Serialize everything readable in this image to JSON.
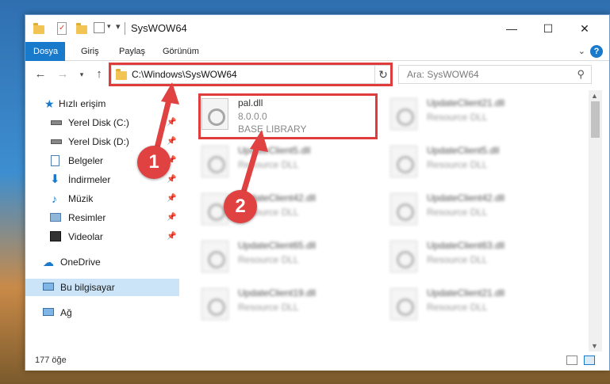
{
  "window": {
    "title": "SysWOW64",
    "controls": {
      "minimize": "—",
      "maximize": "☐",
      "close": "✕"
    }
  },
  "ribbon": {
    "tabs": [
      {
        "label": "Dosya",
        "active": true
      },
      {
        "label": "Giriş"
      },
      {
        "label": "Paylaş"
      },
      {
        "label": "Görünüm"
      }
    ],
    "help": "?"
  },
  "address": {
    "path": "C:\\Windows\\SysWOW64",
    "search_placeholder": "Ara: SysWOW64"
  },
  "sidebar": {
    "items": [
      {
        "label": "Hızlı erişim",
        "icon": "star-icon"
      },
      {
        "label": "Yerel Disk (C:)",
        "icon": "drive-icon",
        "pinned": true
      },
      {
        "label": "Yerel Disk (D:)",
        "icon": "drive-icon",
        "pinned": true
      },
      {
        "label": "Belgeler",
        "icon": "documents-icon",
        "pinned": true
      },
      {
        "label": "İndirmeler",
        "icon": "download-icon",
        "pinned": true
      },
      {
        "label": "Müzik",
        "icon": "music-icon",
        "pinned": true
      },
      {
        "label": "Resimler",
        "icon": "pictures-icon",
        "pinned": true
      },
      {
        "label": "Videolar",
        "icon": "video-icon",
        "pinned": true
      },
      {
        "label": "OneDrive",
        "icon": "cloud-icon"
      },
      {
        "label": "Bu bilgisayar",
        "icon": "computer-icon",
        "selected": true
      },
      {
        "label": "Ağ",
        "icon": "network-icon"
      }
    ]
  },
  "files": [
    {
      "name": "pal.dll",
      "version": "8.0.0.0",
      "description": "BASE LIBRARY",
      "highlighted": true
    },
    {
      "name": "UpdateClient21.dll",
      "description": "Resource DLL"
    },
    {
      "name": "UpdateClient5.dll",
      "description": "Resource DLL"
    },
    {
      "name": "UpdateClient5.dll",
      "description": "Resource DLL"
    },
    {
      "name": "UpdateClient42.dll",
      "description": "Resource DLL"
    },
    {
      "name": "UpdateClient42.dll",
      "description": "Resource DLL"
    },
    {
      "name": "UpdateClient65.dll",
      "description": "Resource DLL"
    },
    {
      "name": "UpdateClient63.dll",
      "description": "Resource DLL"
    },
    {
      "name": "UpdateClient19.dll",
      "description": "Resource DLL"
    },
    {
      "name": "UpdateClient21.dll",
      "description": "Resource DLL"
    }
  ],
  "status": {
    "count": "177 öğe"
  },
  "callouts": {
    "one": "1",
    "two": "2"
  },
  "colors": {
    "accent": "#1979ca",
    "highlight": "#e03c3c",
    "selected": "#cce4f7"
  }
}
